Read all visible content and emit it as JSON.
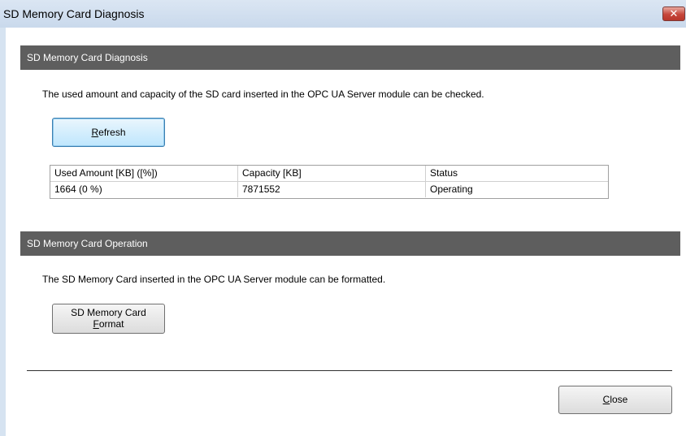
{
  "window": {
    "title": "SD Memory Card Diagnosis",
    "close_glyph": "✕"
  },
  "diagnosis_section": {
    "header": "SD Memory Card Diagnosis",
    "description": "The used amount and capacity of the SD card inserted in the OPC UA Server module can be checked.",
    "refresh_button": {
      "mnemonic": "R",
      "rest": "efresh"
    },
    "table": {
      "columns": [
        "Used Amount [KB] ([%])",
        "Capacity [KB]",
        "Status"
      ],
      "rows": [
        [
          "1664 (0 %)",
          "7871552",
          "Operating"
        ]
      ]
    }
  },
  "operation_section": {
    "header": "SD Memory Card Operation",
    "description": "The SD Memory Card inserted in the OPC UA Server module can be formatted.",
    "format_button": {
      "line1": "SD Memory Card",
      "mnemonic": "F",
      "rest": "ormat"
    }
  },
  "footer": {
    "close_button": {
      "mnemonic": "C",
      "rest": "lose"
    }
  }
}
